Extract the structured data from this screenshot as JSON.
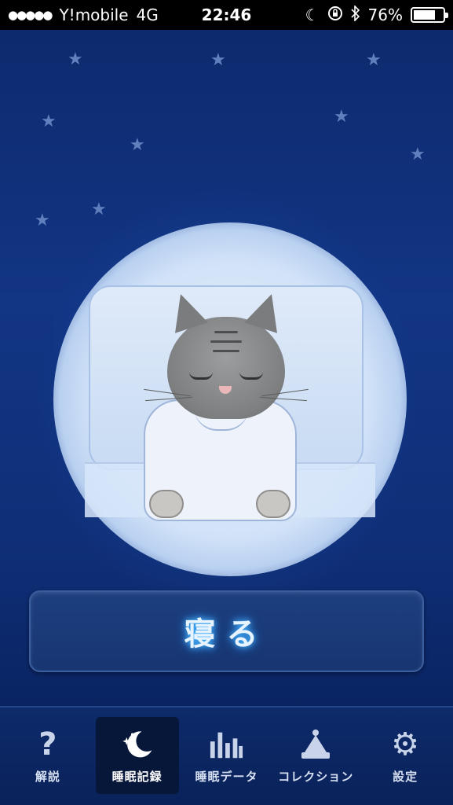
{
  "status_bar": {
    "carrier": "Y!mobile",
    "network": "4G",
    "time": "22:46",
    "battery_percent": "76%",
    "battery_level": 0.76,
    "signal_dots": "●●●●●"
  },
  "main": {
    "sleep_button_label": "寝る"
  },
  "tab_bar": {
    "tabs": [
      {
        "label": "解説",
        "icon": "question-icon",
        "active": false
      },
      {
        "label": "睡眠記録",
        "icon": "moon-stars-icon",
        "active": true
      },
      {
        "label": "睡眠データ",
        "icon": "bar-chart-icon",
        "active": false
      },
      {
        "label": "コレクション",
        "icon": "nightcap-icon",
        "active": false
      },
      {
        "label": "設定",
        "icon": "gear-icon",
        "active": false
      }
    ]
  },
  "colors": {
    "background": "#123584",
    "tab_bar": "#0a225a",
    "button_glow": "#49b7ff"
  }
}
